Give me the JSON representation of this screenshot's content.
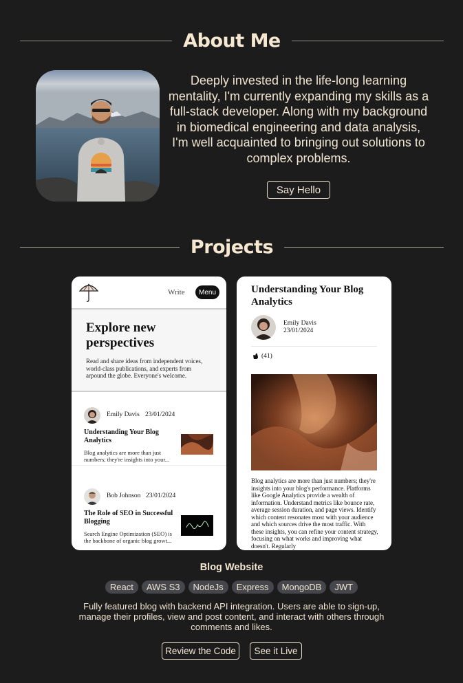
{
  "about": {
    "heading": "About Me",
    "text": "Deeply invested in the life-long learning mentality, I'm currently expanding my skills as a full-stack developer. Along with my background in biomedical engineering and data analysis, I'm well acquainted to bringing out solutions to complex problems.",
    "button_label": "Say Hello"
  },
  "projects": {
    "heading": "Projects",
    "project_name": "Blog Website",
    "tags": [
      "React",
      "AWS S3",
      "NodeJs",
      "Express",
      "MongoDB",
      "JWT"
    ],
    "description": "Fully featured blog with backend API integration. Users are able to sign-up, manage their profiles, view and post content, and interact with others through comments and likes.",
    "review_label": "Review the Code",
    "live_label": "See it Live"
  },
  "preview_left": {
    "nav_write": "Write",
    "nav_menu": "Menu",
    "hero_title": "Explore new perspectives",
    "hero_text": "Read and share ideas from independent voices, world-class publications, and experts from arpound the globe. Everyone's welcome.",
    "posts": [
      {
        "author": "Emily Davis",
        "date": "23/01/2024",
        "title": "Understanding Your Blog Analytics",
        "excerpt": "Blog analytics are more than just numbers; they're insights into your..."
      },
      {
        "author": "Bob Johnson",
        "date": "23/01/2024",
        "title": "The Role of SEO in Successful Blogging",
        "excerpt": "Search Engine Optimization (SEO) is the backbone of organic blog growt..."
      }
    ]
  },
  "preview_right": {
    "title": "Understanding Your Blog Analytics",
    "author": "Emily Davis",
    "date": "23/01/2024",
    "claps": "(41)",
    "body": "Blog analytics are more than just numbers; they're insights into your blog's performance. Platforms like Google Analytics provide a wealth of information. Understand metrics like bounce rate, average session duration, and page views. Identify which content resonates most with your audience and which sources drive the most traffic. With these insights, you can refine your content strategy, focusing on what works and improving what doesn't. Regularly"
  }
}
